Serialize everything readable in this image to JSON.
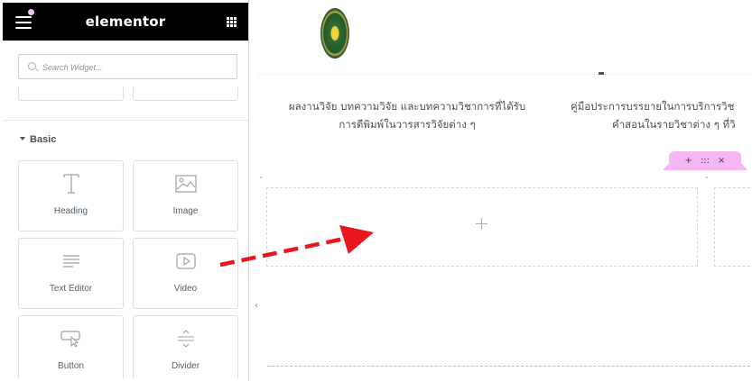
{
  "sidebar": {
    "brand": "elementor",
    "search": {
      "placeholder": "Search Widget..."
    },
    "section_title": "Basic",
    "widgets": [
      {
        "label": "Heading",
        "icon": "heading-icon"
      },
      {
        "label": "Image",
        "icon": "image-icon"
      },
      {
        "label": "Text Editor",
        "icon": "text-editor-icon"
      },
      {
        "label": "Video",
        "icon": "video-icon"
      },
      {
        "label": "Button",
        "icon": "button-icon"
      },
      {
        "label": "Divider",
        "icon": "divider-icon"
      }
    ]
  },
  "canvas": {
    "text_block_1": {
      "line1": "ผลงานวิจัย บทความวิจัย และบทความวิชาการที่ได้รับ",
      "line2": "การตีพิมพ์ในวารสารวิจัยต่าง ๆ"
    },
    "text_block_2": {
      "line1": "คู่มือประการบรรยายในการบริการวิช",
      "line2": "คำสอนในรายวิชาต่าง ๆ ที่วิ"
    },
    "section_handle": {
      "add": "+",
      "move": ":::",
      "remove": "×"
    },
    "collapse_glyph": "‹"
  },
  "colors": {
    "topbar": "#000000",
    "handle": "#f4b7f4",
    "arrow": "#e8171f",
    "accent_dot": "#e8c6f0"
  }
}
